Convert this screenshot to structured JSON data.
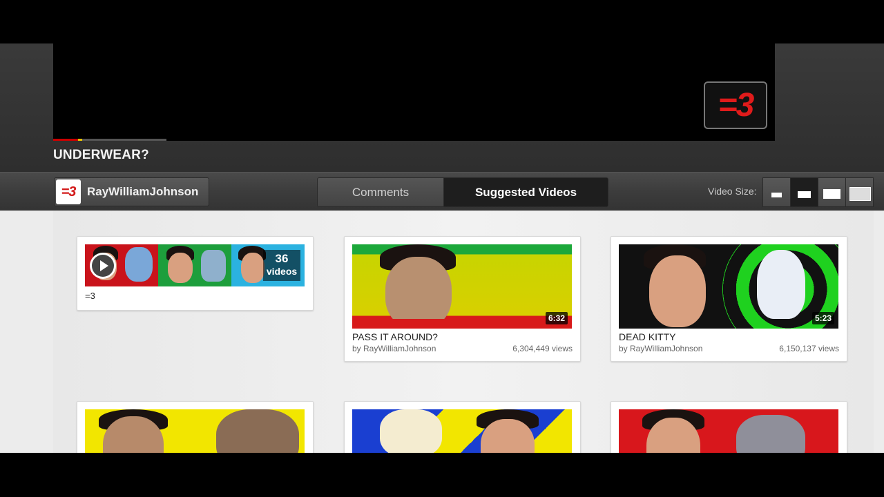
{
  "video": {
    "title": "UNDERWEAR?",
    "player_logo": "=3"
  },
  "toolbar": {
    "channel_avatar": "=3",
    "channel_name": "RayWilliamJohnson",
    "tabs": [
      {
        "label": "Comments",
        "active": false
      },
      {
        "label": "Suggested Videos",
        "active": true
      }
    ],
    "video_size_label": "Video Size:",
    "video_size_options": [
      "small",
      "medium",
      "large",
      "fullscreen"
    ],
    "video_size_selected": "medium"
  },
  "playlist": {
    "count": "36",
    "count_label": "videos",
    "title": "=3"
  },
  "videos": [
    {
      "title": "PASS IT AROUND?",
      "by": "by RayWilliamJohnson",
      "views": "6,304,449 views",
      "duration": "6:32"
    },
    {
      "title": "DEAD KITTY",
      "by": "by RayWilliamJohnson",
      "views": "6,150,137 views",
      "duration": "5:23"
    }
  ],
  "colors": {
    "accent_red": "#e01b1b",
    "toolbar_bg": "#3c3c3c",
    "active_tab_bg": "#1e1e1e",
    "content_bg": "#ececec"
  }
}
